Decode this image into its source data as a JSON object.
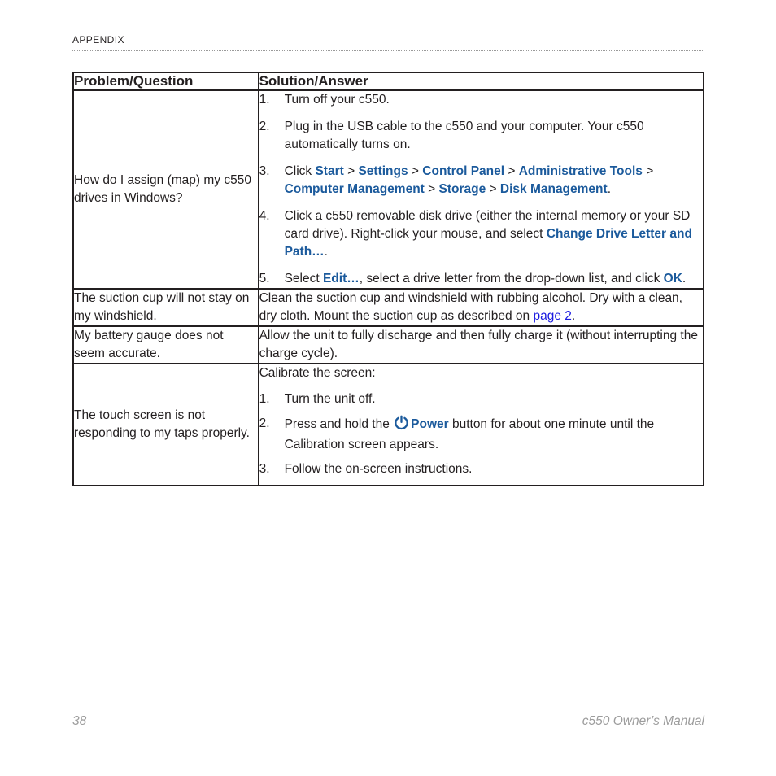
{
  "header": {
    "running_title": "Appendix"
  },
  "table": {
    "columns": [
      "Problem/Question",
      "Solution/Answer"
    ],
    "rows": [
      {
        "question": "How do I assign (map) my c550 drives in Windows?",
        "steps": [
          {
            "num": "1.",
            "text": "Turn off your c550."
          },
          {
            "num": "2.",
            "text": "Plug in the USB cable to the c550 and your computer. Your c550 automatically turns on."
          },
          {
            "num": "3.",
            "lead": "Click ",
            "path": [
              "Start",
              "Settings",
              "Control Panel",
              "Administrative Tools",
              "Computer Management",
              "Storage",
              "Disk Management"
            ],
            "separator": ">",
            "trail": "."
          },
          {
            "num": "4.",
            "lead": "Click a c550 removable disk drive (either the internal memory or your SD card drive). Right-click your mouse, and select ",
            "bold": "Change Drive Letter and Path…",
            "trail": "."
          },
          {
            "num": "5.",
            "lead": "Select ",
            "bold": "Edit…",
            "mid": ", select a drive letter from the drop-down list, and click ",
            "bold2": "OK",
            "trail": "."
          }
        ]
      },
      {
        "question": "The suction cup will not stay on my windshield.",
        "answer_lead": "Clean the suction cup and windshield with rubbing alcohol. Dry with a clean, dry cloth. Mount the suction cup as described on ",
        "answer_link": "page 2",
        "answer_trail": "."
      },
      {
        "question": "My battery gauge does not seem accurate.",
        "answer": "Allow the unit to fully discharge and then fully charge it (without interrupting the charge cycle)."
      },
      {
        "question": "The touch screen is not responding to my taps properly.",
        "intro": "Calibrate the screen:",
        "steps": [
          {
            "num": "1.",
            "text": "Turn the unit off."
          },
          {
            "num": "2.",
            "lead": "Press and hold the ",
            "icon": "power-icon",
            "bold": "Power",
            "trail": " button for about one minute until the Calibration screen appears."
          },
          {
            "num": "3.",
            "text": "Follow the on-screen instructions."
          }
        ]
      }
    ]
  },
  "footer": {
    "page_number": "38",
    "manual_title": "c550 Owner’s Manual"
  },
  "colors": {
    "bold_blue": "#1b5a9c",
    "link_blue": "#1a1ae0",
    "text": "#231f20",
    "footer_gray": "#9d9d9d",
    "rule_gray": "#9a9a9a"
  }
}
